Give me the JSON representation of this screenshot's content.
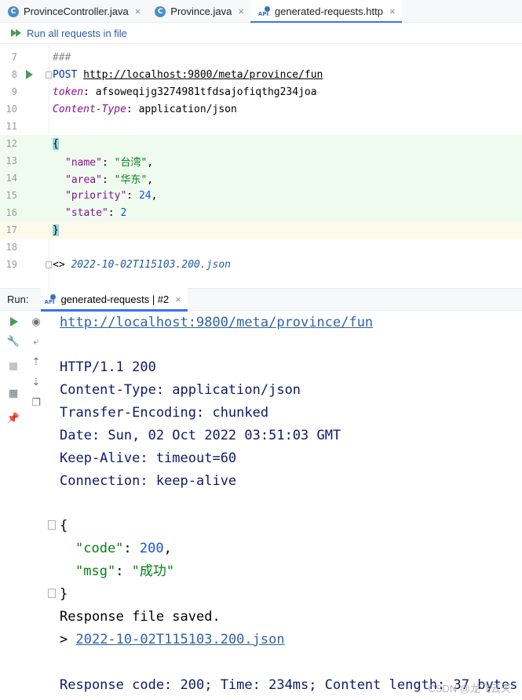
{
  "tabs": [
    {
      "label": "ProvinceController.java",
      "icon": "java-class-icon"
    },
    {
      "label": "Province.java",
      "icon": "java-class-icon"
    },
    {
      "label": "generated-requests.http",
      "icon": "api-file-icon",
      "active": true
    }
  ],
  "toolbar": {
    "run_all_label": "Run all requests in file"
  },
  "editor": {
    "lines": [
      {
        "n": "7",
        "comment": "###"
      },
      {
        "n": "8",
        "method": "POST",
        "url": "http://localhost:9800/meta/province/fun"
      },
      {
        "n": "9",
        "header_name": "token",
        "header_value": "afsoweqijg3274981tfdsajofiqthg234joa"
      },
      {
        "n": "10",
        "header_name": "Content-Type",
        "header_value": "application/json"
      },
      {
        "n": "11"
      },
      {
        "n": "12",
        "text": "{"
      },
      {
        "n": "13",
        "key": "\"name\"",
        "value": "\"台湾\""
      },
      {
        "n": "14",
        "key": "\"area\"",
        "value": "\"华东\""
      },
      {
        "n": "15",
        "key": "\"priority\"",
        "value": "24"
      },
      {
        "n": "16",
        "key": "\"state\"",
        "value": "2"
      },
      {
        "n": "17",
        "text": "}"
      },
      {
        "n": "18"
      },
      {
        "n": "19",
        "prefix": "<> ",
        "response_file": "2022-10-02T115103.200.json"
      }
    ]
  },
  "run_panel": {
    "run_label": "Run:",
    "tab_label": "generated-requests | #2"
  },
  "console": {
    "url": "http://localhost:9800/meta/province/fun",
    "status": "HTTP/1.1 200",
    "headers": [
      "Content-Type: application/json",
      "Transfer-Encoding: chunked",
      "Date: Sun, 02 Oct 2022 03:51:03 GMT",
      "Keep-Alive: timeout=60",
      "Connection: keep-alive"
    ],
    "body_open": "{",
    "code_key": "\"code\"",
    "code_value": "200",
    "msg_key": "\"msg\"",
    "msg_value": "\"成功\"",
    "body_close": "}",
    "saved_text": "Response file saved.",
    "saved_prefix": "> ",
    "saved_file": "2022-10-02T115103.200.json",
    "summary": "Response code: 200; Time: 234ms; Content length: 37 bytes"
  },
  "watermark": "CSDN @龙飞云天"
}
